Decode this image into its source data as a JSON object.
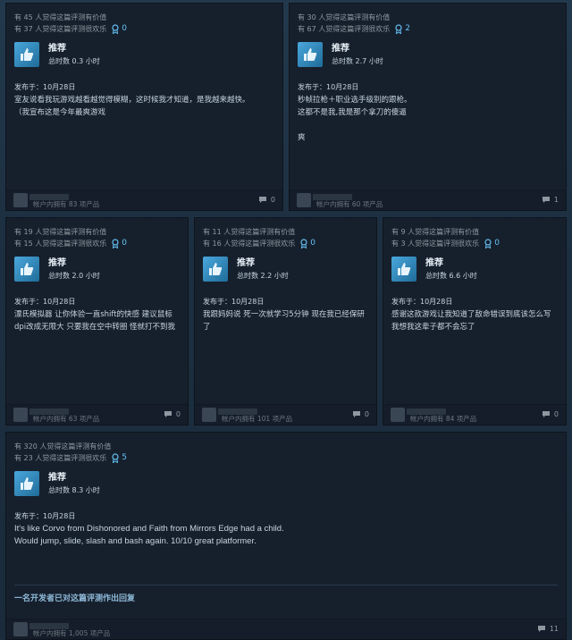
{
  "reviews": [
    {
      "helpful_line": "有 45 人觉得这篇评测有价值",
      "funny_line": "有 37 人觉得这篇评测很欢乐",
      "award_count": "0",
      "recommend_label": "推荐",
      "hours": "总时数 0.3 小时",
      "posted": "发布于：10月28日",
      "text": "室友说看我玩游戏越看越觉得模糊，这时候我才知道，是我越来越快。\n（我宣布这是今年最爽游戏",
      "products": "帐户内拥有 83 项产品",
      "comments": "0"
    },
    {
      "helpful_line": "有 30 人觉得这篇评测有价值",
      "funny_line": "有 67 人觉得这篇评测很欢乐",
      "award_count": "2",
      "recommend_label": "推荐",
      "hours": "总时数 2.7 小时",
      "posted": "发布于：10月28日",
      "text": "秒帧拉枪＋职业选手级别的跟枪。\n这都不是我,我是那个拿刀的傻逼\n\n爽",
      "products": "帐户内拥有 60 项产品",
      "comments": "1"
    },
    {
      "helpful_line": "有 19 人觉得这篇评测有价值",
      "funny_line": "有 15 人觉得这篇评测很欢乐",
      "award_count": "0",
      "recommend_label": "推荐",
      "hours": "总时数 2.0 小时",
      "posted": "发布于：10月28日",
      "text": "漂氏模拟器 让你体验一直shift的快感 建议鼠标dpi改成无限大 只要我在空中转圈 怪就打不到我",
      "products": "帐户内拥有 63 项产品",
      "comments": "0"
    },
    {
      "helpful_line": "有 11 人觉得这篇评测有价值",
      "funny_line": "有 16 人觉得这篇评测很欢乐",
      "award_count": "0",
      "recommend_label": "推荐",
      "hours": "总时数 2.2 小时",
      "posted": "发布于：10月28日",
      "text": "我跟妈妈说 死一次就学习5分钟 现在我已经保研了",
      "products": "帐户内拥有 101 项产品",
      "comments": "0"
    },
    {
      "helpful_line": "有 9 人觉得这篇评测有价值",
      "funny_line": "有 3 人觉得这篇评测很欢乐",
      "award_count": "0",
      "recommend_label": "推荐",
      "hours": "总时数 6.6 小时",
      "posted": "发布于：10月28日",
      "text": "感谢这款游戏让我知道了敌命错误到底该怎么写 我想我这辈子都不会忘了",
      "products": "帐户内拥有 84 项产品",
      "comments": "0"
    },
    {
      "helpful_line": "有 320 人觉得这篇评测有价值",
      "funny_line": "有 23 人觉得这篇评测很欢乐",
      "award_count": "5",
      "recommend_label": "推荐",
      "hours": "总时数 8.3 小时",
      "posted": "发布于：10月28日",
      "text": "It's like Corvo from Dishonored and Faith from Mirrors Edge had a child.\nWould jump, slide, slash and bash again. 10/10 great platformer.",
      "dev_response": "一名开发者已对这篇评测作出回复",
      "products": "帐户内拥有 1,005 项产品",
      "comments": "11"
    }
  ]
}
